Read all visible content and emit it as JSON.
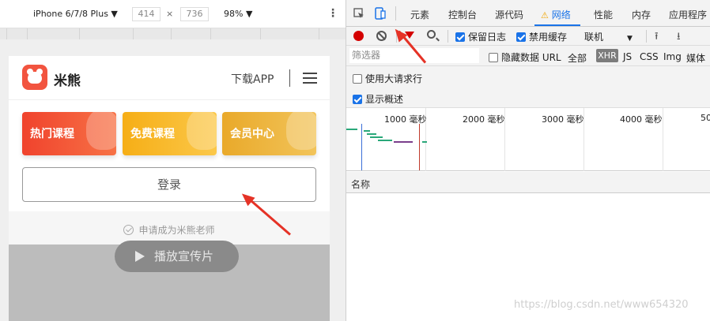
{
  "device_toolbar": {
    "device": "iPhone 6/7/8 Plus",
    "width": "414",
    "times": "×",
    "height": "736",
    "zoom": "98%",
    "more": "⋮"
  },
  "phone": {
    "brand": "米熊",
    "download": "下载APP",
    "cards": [
      {
        "label": "热门课程",
        "color": "#f0432d"
      },
      {
        "label": "免费课程",
        "color": "#f6ae16"
      },
      {
        "label": "会员中心",
        "color": "#e9a92a"
      }
    ],
    "login": "登录",
    "apply": "申请成为米熊老师",
    "play": "播放宣传片"
  },
  "devtools": {
    "tabs": [
      "元素",
      "控制台",
      "源代码",
      "网络",
      "性能",
      "内存",
      "应用程序"
    ],
    "active_tab": "网络",
    "preserve_log": "保留日志",
    "disable_cache": "禁用缓存",
    "throttle": "联机",
    "filter_placeholder": "筛选器",
    "hide_data_urls": "隐藏数据 URL",
    "types": [
      "全部",
      "XHR",
      "JS",
      "CSS",
      "Img",
      "媒体"
    ],
    "big_rows": "使用大请求行",
    "overview": "显示概述",
    "timeline_labels": [
      "1000 毫秒",
      "2000 毫秒",
      "3000 毫秒",
      "4000 毫秒",
      "50"
    ],
    "name_col": "名称"
  },
  "watermark": "https://blog.csdn.net/www654320",
  "colors": {
    "accent": "#1a73e8",
    "record": "#d40000",
    "annotation": "#e53226"
  }
}
